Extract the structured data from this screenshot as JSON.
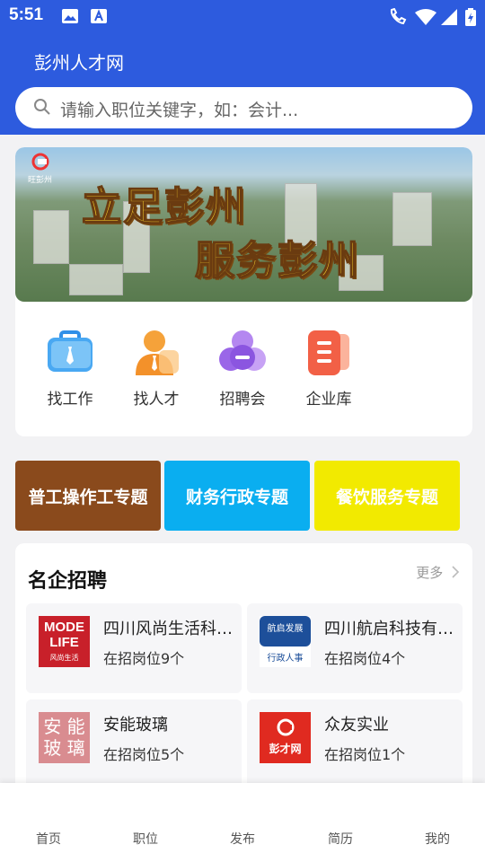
{
  "status": {
    "time": "5:51"
  },
  "header": {
    "title": "彭州人才网"
  },
  "search": {
    "placeholder": "请输入职位关键字，如：会计..."
  },
  "banner": {
    "line1": "立足彭州",
    "line2": "服务彭州",
    "logo_text": "旺彭州"
  },
  "quick_links": [
    {
      "label": "找工作",
      "icon": "briefcase-icon"
    },
    {
      "label": "找人才",
      "icon": "person-icon"
    },
    {
      "label": "招聘会",
      "icon": "meeting-icon"
    },
    {
      "label": "企业库",
      "icon": "document-icon"
    }
  ],
  "topics": [
    {
      "label": "普工操作工专题",
      "color": "#8a4a1c"
    },
    {
      "label": "财务行政专题",
      "color": "#0aaef0"
    },
    {
      "label": "餐饮服务专题",
      "color": "#f2ea00"
    }
  ],
  "famous": {
    "title": "名企招聘",
    "more": "更多",
    "companies": [
      {
        "name": "四川风尚生活科技有限公司",
        "count": "在招岗位9个",
        "logo_line1": "MODE",
        "logo_line2": "LIFE",
        "logo_sub": "风尚生活"
      },
      {
        "name": "四川航启科技有限公司",
        "count": "在招岗位4个",
        "logo_line1": "航启发展",
        "logo_sub": "行政人事"
      },
      {
        "name": "安能玻璃",
        "count": "在招岗位5个",
        "logo_line1": "安 能",
        "logo_line2": "玻 璃"
      },
      {
        "name": "众友实业",
        "count": "在招岗位1个",
        "logo_line1": "彭才网"
      }
    ]
  },
  "nav": [
    {
      "label": "首页"
    },
    {
      "label": "职位"
    },
    {
      "label": "发布"
    },
    {
      "label": "简历"
    },
    {
      "label": "我的"
    }
  ]
}
